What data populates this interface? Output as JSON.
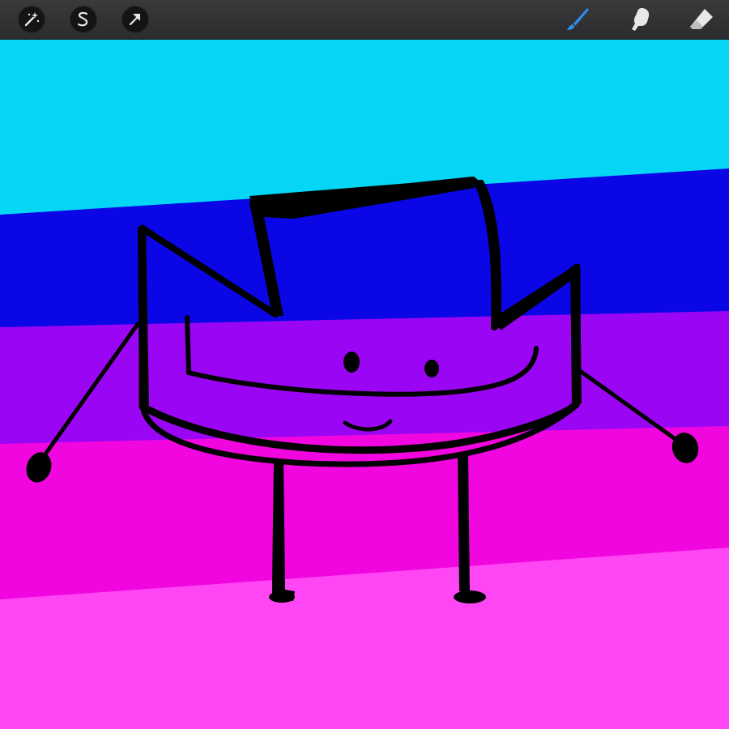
{
  "app": "Procreate",
  "toolbar": {
    "left_tools": [
      {
        "name": "adjustments",
        "icon": "magic-wand-icon"
      },
      {
        "name": "selection",
        "icon": "selection-s-icon"
      },
      {
        "name": "transform",
        "icon": "arrow-cursor-icon"
      }
    ],
    "right_tools": [
      {
        "name": "brush",
        "icon": "brush-icon",
        "active": true
      },
      {
        "name": "smudge",
        "icon": "smudge-finger-icon",
        "active": false
      },
      {
        "name": "eraser",
        "icon": "eraser-icon",
        "active": false
      }
    ]
  },
  "colors": {
    "toolbar_bg": "#2c2c2e",
    "active_tool": "#2f8ff0",
    "inactive_tool": "#e8e8e8",
    "stripe_cyan": "#06d6f6",
    "stripe_blue": "#0a06e6",
    "stripe_purple": "#9a06f4",
    "stripe_magenta": "#f206e0",
    "stripe_pink": "#ff46f4",
    "ink": "#000000"
  },
  "canvas": {
    "artwork": "crown-character-drawing",
    "stripe_order": [
      "cyan",
      "blue",
      "purple",
      "magenta",
      "pink"
    ]
  }
}
